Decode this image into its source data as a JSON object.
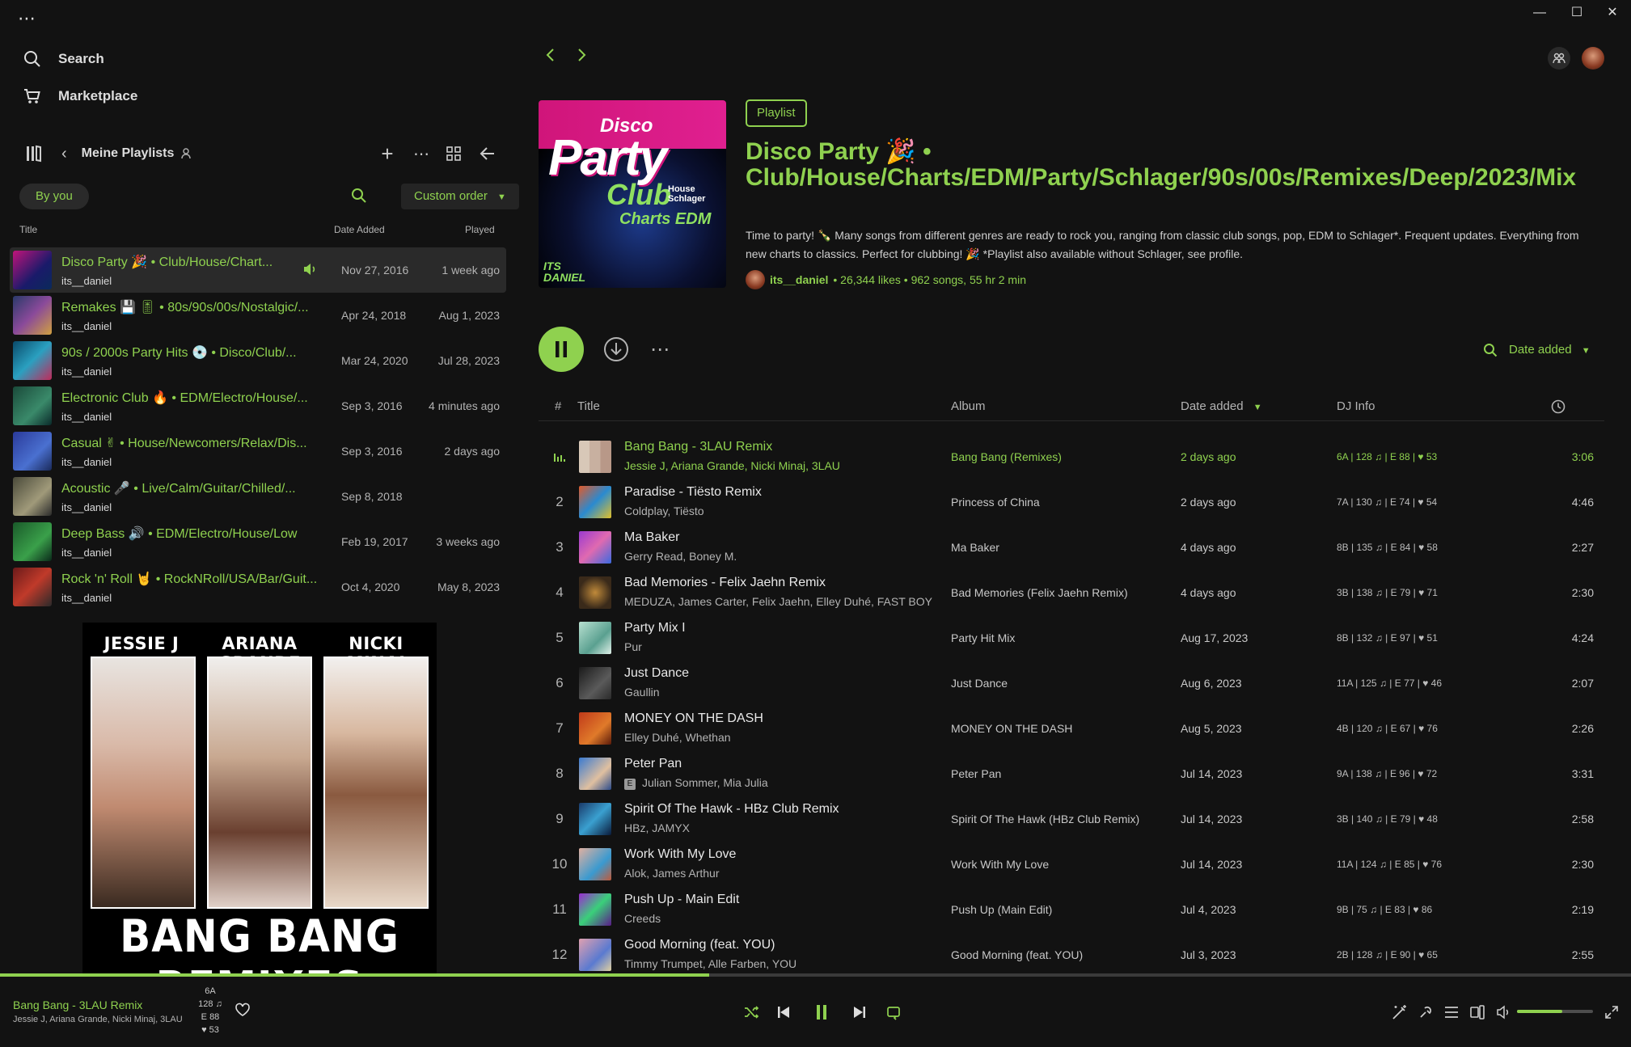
{
  "window": {
    "menu_dots": "⋯"
  },
  "sidebar": {
    "nav": [
      {
        "label": "Search",
        "icon": "search-icon"
      },
      {
        "label": "Marketplace",
        "icon": "cart-icon"
      }
    ],
    "library": {
      "title": "Meine Playlists",
      "filter_chip": "By you",
      "sort_label": "Custom order"
    },
    "columns": {
      "title": "Title",
      "date_added": "Date Added",
      "played": "Played"
    },
    "playlists": [
      {
        "title": "Disco Party 🎉 • Club/House/Chart...",
        "owner": "its__daniel",
        "date": "Nov 27, 2016",
        "played": "1 week ago",
        "active": true,
        "thumb": "linear-gradient(135deg,#c0147a,#1a1a6a 60%,#0a2a5a)"
      },
      {
        "title": "Remakes 💾 🎚 • 80s/90s/00s/Nostalgic/...",
        "owner": "its__daniel",
        "date": "Apr 24, 2018",
        "played": "Aug 1, 2023",
        "thumb": "linear-gradient(135deg,#2a3a6a,#8a4a9a 50%,#d0a040)"
      },
      {
        "title": "90s / 2000s Party Hits 💿 • Disco/Club/...",
        "owner": "its__daniel",
        "date": "Mar 24, 2020",
        "played": "Jul 28, 2023",
        "thumb": "linear-gradient(135deg,#0a4a6a,#2aa0c0 50%,#c02a5a)"
      },
      {
        "title": "Electronic Club 🔥 • EDM/Electro/House/...",
        "owner": "its__daniel",
        "date": "Sep 3, 2016",
        "played": "4 minutes ago",
        "thumb": "linear-gradient(135deg,#1a4a3a,#3a8a6a 60%,#0a2a2a)"
      },
      {
        "title": "Casual ✌ • House/Newcomers/Relax/Dis...",
        "owner": "its__daniel",
        "date": "Sep 3, 2016",
        "played": "2 days ago",
        "thumb": "linear-gradient(135deg,#2a3a9a,#4a70d0 60%,#1a2a5a)"
      },
      {
        "title": "Acoustic 🎤 • Live/Calm/Guitar/Chilled/...",
        "owner": "its__daniel",
        "date": "Sep 8, 2018",
        "played": "",
        "thumb": "linear-gradient(135deg,#4a4a3a,#a09a7a 60%,#2a2a2a)"
      },
      {
        "title": "Deep Bass 🔊 • EDM/Electro/House/Low",
        "owner": "its__daniel",
        "date": "Feb 19, 2017",
        "played": "3 weeks ago",
        "thumb": "linear-gradient(135deg,#1a5a2a,#3aa04a 60%,#0a2a1a)"
      },
      {
        "title": "Rock 'n' Roll 🤘 • RockNRoll/USA/Bar/Guit...",
        "owner": "its__daniel",
        "date": "Oct 4, 2020",
        "played": "May 8, 2023",
        "thumb": "linear-gradient(135deg,#6a1a1a,#c03a2a 50%,#2a2a2a)"
      }
    ],
    "cover_preview": {
      "artists": [
        "JESSIE J",
        "ARIANA GRANDE",
        "NICKI MINAJ"
      ],
      "caption": "BANG BANG REMIXES"
    }
  },
  "playlist": {
    "type": "Playlist",
    "title": "Disco Party 🎉 • Club/House/Charts/EDM/Party/Schlager/90s/00s/Remixes/Deep/2023/Mix",
    "description": "Time to party! 🍾 Many songs from different genres are ready to rock you, ranging from classic club songs, pop, EDM to Schlager*. Frequent updates. Everything from new charts to classics. Perfect for clubbing! 🎉 *Playlist also available without Schlager, see profile.",
    "owner": "its__daniel",
    "stats": "• 26,344 likes • 962 songs, 55 hr 2 min",
    "cover_text": {
      "line1": "Disco",
      "line2": "Party",
      "line3": "Club",
      "line4": "House Schlager",
      "line5": "Charts EDM",
      "line6": "ITS DANIEL"
    },
    "sort_label": "Date added",
    "columns": {
      "num": "#",
      "title": "Title",
      "album": "Album",
      "date_added": "Date added",
      "dj": "DJ Info"
    },
    "tracks": [
      {
        "num": "",
        "title": "Bang Bang - 3LAU Remix",
        "artists": "Jessie J, Ariana Grande, Nicki Minaj, 3LAU",
        "album": "Bang Bang (Remixes)",
        "date": "2 days ago",
        "dj": "6A | 128 ♫ | E 88 | ♥ 53",
        "dur": "3:06",
        "playing": true,
        "art": "linear-gradient(90deg,#d8c8b8 0 33%,#c8b0a0 33% 66%,#b89888 66%)"
      },
      {
        "num": "2",
        "title": "Paradise - Tiësto Remix",
        "artists": "Coldplay, Tiësto",
        "album": "Princess of China",
        "date": "2 days ago",
        "dj": "7A | 130 ♫ | E 74 | ♥ 54",
        "dur": "4:46",
        "art": "linear-gradient(135deg,#e05a2a,#2a8ad0 50%,#e0c02a)"
      },
      {
        "num": "3",
        "title": "Ma Baker",
        "artists": "Gerry Read, Boney M.",
        "album": "Ma Baker",
        "date": "4 days ago",
        "dj": "8B | 135 ♫ | E 84 | ♥ 58",
        "dur": "2:27",
        "art": "linear-gradient(135deg,#9a3ad0,#e06ab0 50%,#3a6ae0)"
      },
      {
        "num": "4",
        "title": "Bad Memories - Felix Jaehn Remix",
        "artists": "MEDUZA, James Carter, Felix Jaehn, Elley Duhé, FAST BOY",
        "album": "Bad Memories (Felix Jaehn Remix)",
        "date": "4 days ago",
        "dj": "3B | 138 ♫ | E 79 | ♥ 71",
        "dur": "2:30",
        "art": "radial-gradient(circle,#c08a3a,#3a2a1a 70%)"
      },
      {
        "num": "5",
        "title": "Party Mix I",
        "artists": "Pur",
        "album": "Party Hit Mix",
        "date": "Aug 17, 2023",
        "dj": "8B | 132 ♫ | E 97 | ♥ 51",
        "dur": "4:24",
        "art": "linear-gradient(135deg,#b8e0d0,#5aa090 60%,#e0f0e8)"
      },
      {
        "num": "6",
        "title": "Just Dance",
        "artists": "Gaullin",
        "album": "Just Dance",
        "date": "Aug 6, 2023",
        "dj": "11A | 125 ♫ | E 77 | ♥ 46",
        "dur": "2:07",
        "art": "linear-gradient(135deg,#1a1a1a,#5a5a5a 60%,#2a2a2a)"
      },
      {
        "num": "7",
        "title": "MONEY ON THE DASH",
        "artists": "Elley Duhé, Whethan",
        "album": "MONEY ON THE DASH",
        "date": "Aug 5, 2023",
        "dj": "4B | 120 ♫ | E 67 | ♥ 76",
        "dur": "2:26",
        "art": "linear-gradient(135deg,#c03a1a,#e07a2a 60%,#5a1a0a)"
      },
      {
        "num": "8",
        "title": "Peter Pan",
        "artists": "Julian Sommer, Mia Julia",
        "explicit": "E",
        "album": "Peter Pan",
        "date": "Jul 14, 2023",
        "dj": "9A | 138 ♫ | E 96 | ♥ 72",
        "dur": "3:31",
        "art": "linear-gradient(135deg,#3a7ad0,#e0c0a0 60%,#2a4a8a)"
      },
      {
        "num": "9",
        "title": "Spirit Of The Hawk - HBz Club Remix",
        "artists": "HBz, JAMYX",
        "album": "Spirit Of The Hawk (HBz Club Remix)",
        "date": "Jul 14, 2023",
        "dj": "3B | 140 ♫ | E 79 | ♥ 48",
        "dur": "2:58",
        "art": "linear-gradient(135deg,#1a3a6a,#3aa0d0 50%,#0a1a3a)"
      },
      {
        "num": "10",
        "title": "Work With My Love",
        "artists": "Alok, James Arthur",
        "album": "Work With My Love",
        "date": "Jul 14, 2023",
        "dj": "11A | 124 ♫ | E 85 | ♥ 76",
        "dur": "2:30",
        "art": "linear-gradient(135deg,#e0b0a0,#3a9ad0 60%,#c05a3a)"
      },
      {
        "num": "11",
        "title": "Push Up - Main Edit",
        "artists": "Creeds",
        "album": "Push Up (Main Edit)",
        "date": "Jul 4, 2023",
        "dj": "9B | 75 ♫ | E 83 | ♥ 86",
        "dur": "2:19",
        "art": "linear-gradient(135deg,#9a2ad0,#3ad07a 50%,#5a1a8a)"
      },
      {
        "num": "12",
        "title": "Good Morning (feat. YOU)",
        "artists": "Timmy Trumpet, Alle Farben, YOU",
        "album": "Good Morning (feat. YOU)",
        "date": "Jul 3, 2023",
        "dj": "2B | 128 ♫ | E 90 | ♥ 65",
        "dur": "2:55",
        "art": "linear-gradient(135deg,#e0a0b0,#5a7ad0 60%,#e0d0a0)"
      }
    ]
  },
  "player": {
    "title": "Bang Bang - 3LAU Remix",
    "artists": "Jessie J, Ariana Grande, Nicki Minaj, 3LAU",
    "dj": {
      "key": "6A",
      "bpm": "128 ♫",
      "energy": "E 88",
      "likes": "♥ 53"
    },
    "progress": 0.435,
    "volume": 0.6
  },
  "colors": {
    "accent": "#8fd14f",
    "background": "#121212",
    "row_active": "#2a2a2a"
  }
}
